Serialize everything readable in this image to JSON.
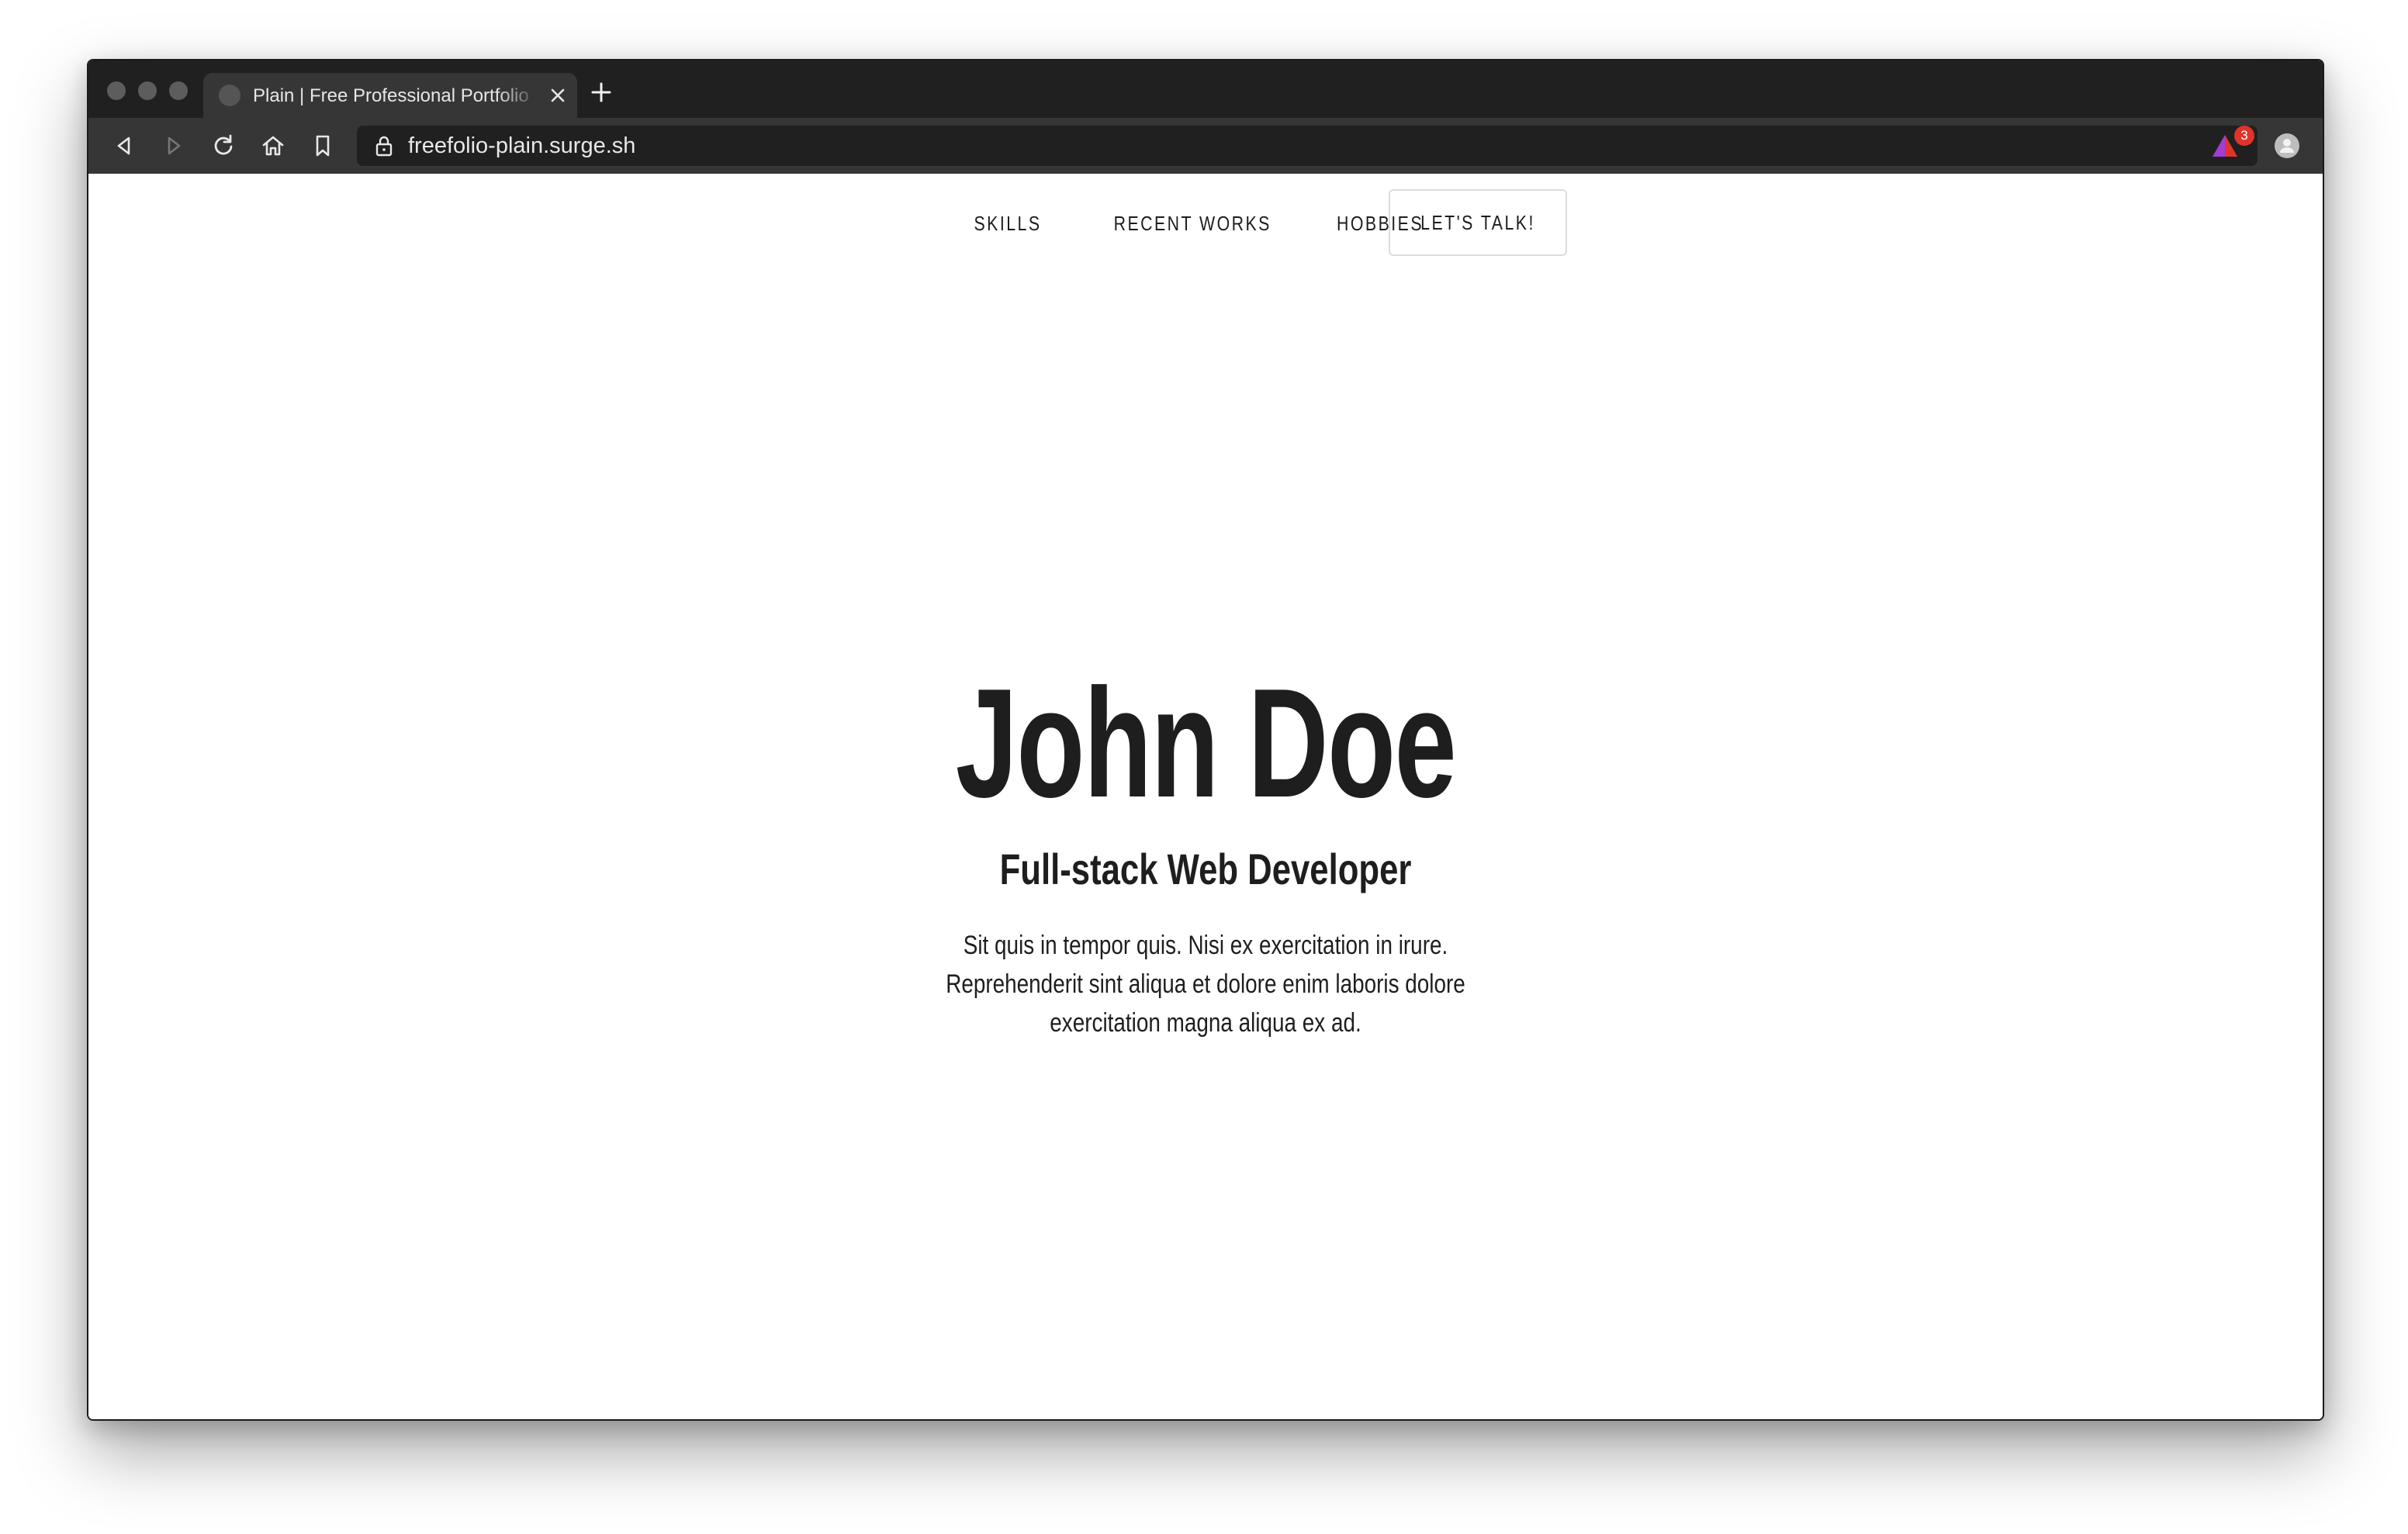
{
  "browser": {
    "tab": {
      "title": "Plain | Free Professional Portfolio",
      "close_icon": "close-icon",
      "favicon_icon": "globe-icon"
    },
    "new_tab_icon": "plus-icon",
    "toolbar": {
      "back_icon": "back-arrow-icon",
      "forward_icon": "forward-arrow-icon",
      "reload_icon": "reload-icon",
      "home_icon": "home-icon",
      "bookmark_icon": "bookmark-icon"
    },
    "address": {
      "url": "freefolio-plain.surge.sh",
      "lock_icon": "lock-icon"
    },
    "extensions": {
      "brave_shield_icon": "brave-shield-icon",
      "rewards_icon": "brave-rewards-icon",
      "rewards_badge": "3",
      "profile_icon": "profile-avatar-icon"
    }
  },
  "site": {
    "nav": {
      "items": [
        "SKILLS",
        "RECENT WORKS",
        "HOBBIES"
      ],
      "cta": "LET'S TALK!"
    },
    "hero": {
      "name": "John Doe",
      "title": "Full-stack Web Developer",
      "description": "Sit quis in tempor quis. Nisi ex exercitation in irure. Reprehenderit sint aliqua et dolore enim laboris dolore exercitation magna aliqua ex ad."
    }
  },
  "colors": {
    "tabstrip": "#202020",
    "toolbar": "#363636",
    "page_bg": "#ffffff",
    "text": "#1e1e1e",
    "badge": "#e0342b"
  }
}
